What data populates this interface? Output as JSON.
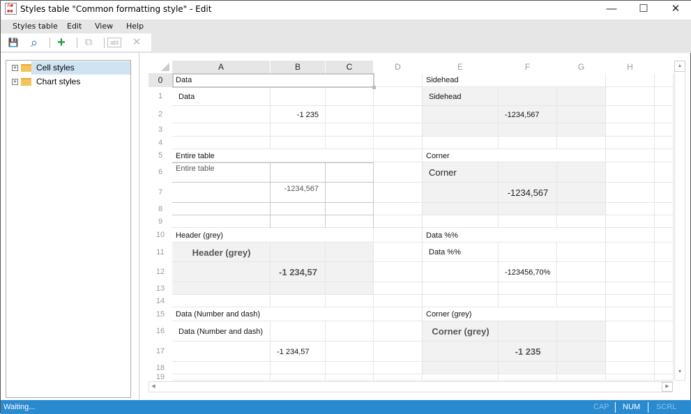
{
  "window": {
    "title": "Styles table \"Common formatting style\" - Edit",
    "minimize": "—",
    "maximize": "☐",
    "close": "✕"
  },
  "menu": [
    "Styles table",
    "Edit",
    "View",
    "Help"
  ],
  "toolbar": {
    "save": "💾",
    "search": "⌕",
    "add": "+",
    "copy": "⧉",
    "rename": "abl",
    "delete": "✕"
  },
  "tree": [
    {
      "label": "Cell styles",
      "selected": true
    },
    {
      "label": "Chart styles",
      "selected": false
    }
  ],
  "columns": [
    "A",
    "B",
    "C",
    "D",
    "E",
    "F",
    "G",
    "H"
  ],
  "rows": [
    "0",
    "1",
    "2",
    "3",
    "4",
    "5",
    "6",
    "7",
    "8",
    "9",
    "10",
    "11",
    "12",
    "13",
    "14",
    "15",
    "16",
    "17",
    "18",
    "19"
  ],
  "cells": [
    {
      "r": 0,
      "c": 0,
      "text": "Data",
      "cls": ""
    },
    {
      "r": 1,
      "c": 0,
      "text": "Data",
      "cls": "ind"
    },
    {
      "r": 2,
      "c": 1,
      "text": "-1 235",
      "cls": "right"
    },
    {
      "r": 5,
      "c": 0,
      "text": "Entire table",
      "cls": ""
    },
    {
      "r": 6,
      "c": 0,
      "text": "Entire table",
      "cls": "top gray"
    },
    {
      "r": 7,
      "c": 1,
      "text": "-1234,567",
      "cls": "right top gray"
    },
    {
      "r": 10,
      "c": 0,
      "text": "Header (grey)",
      "cls": ""
    },
    {
      "r": 11,
      "c": 0,
      "text": "Header (grey)",
      "cls": "center bold big"
    },
    {
      "r": 12,
      "c": 1,
      "text": "-1 234,57",
      "cls": "center bold big"
    },
    {
      "r": 15,
      "c": 0,
      "text": "Data (Number and dash)",
      "cls": ""
    },
    {
      "r": 16,
      "c": 0,
      "text": "Data (Number and dash)",
      "cls": "ind"
    },
    {
      "r": 17,
      "c": 1,
      "text": "-1 234,57",
      "cls": "ind"
    },
    {
      "r": 0,
      "c": 4,
      "text": "Sidehead",
      "cls": ""
    },
    {
      "r": 1,
      "c": 4,
      "text": "Sidehead",
      "cls": "ind"
    },
    {
      "r": 2,
      "c": 5,
      "text": "-1234,567",
      "cls": "ind"
    },
    {
      "r": 5,
      "c": 4,
      "text": "Corner",
      "cls": ""
    },
    {
      "r": 6,
      "c": 4,
      "text": "Corner",
      "cls": "ind big2"
    },
    {
      "r": 7,
      "c": 5,
      "text": "-1234,567",
      "cls": "center big2"
    },
    {
      "r": 10,
      "c": 4,
      "text": "Data %%",
      "cls": ""
    },
    {
      "r": 11,
      "c": 4,
      "text": "Data %%",
      "cls": "ind"
    },
    {
      "r": 12,
      "c": 5,
      "text": "-123456,70%",
      "cls": "ind"
    },
    {
      "r": 15,
      "c": 4,
      "text": "Corner (grey)",
      "cls": ""
    },
    {
      "r": 16,
      "c": 4,
      "text": "Corner (grey)",
      "cls": "center bold big"
    },
    {
      "r": 17,
      "c": 5,
      "text": "-1 235",
      "cls": "center bold big"
    }
  ],
  "status": {
    "text": "Waiting...",
    "cap": "CAP",
    "num": "NUM",
    "scrl": "SCRL"
  }
}
